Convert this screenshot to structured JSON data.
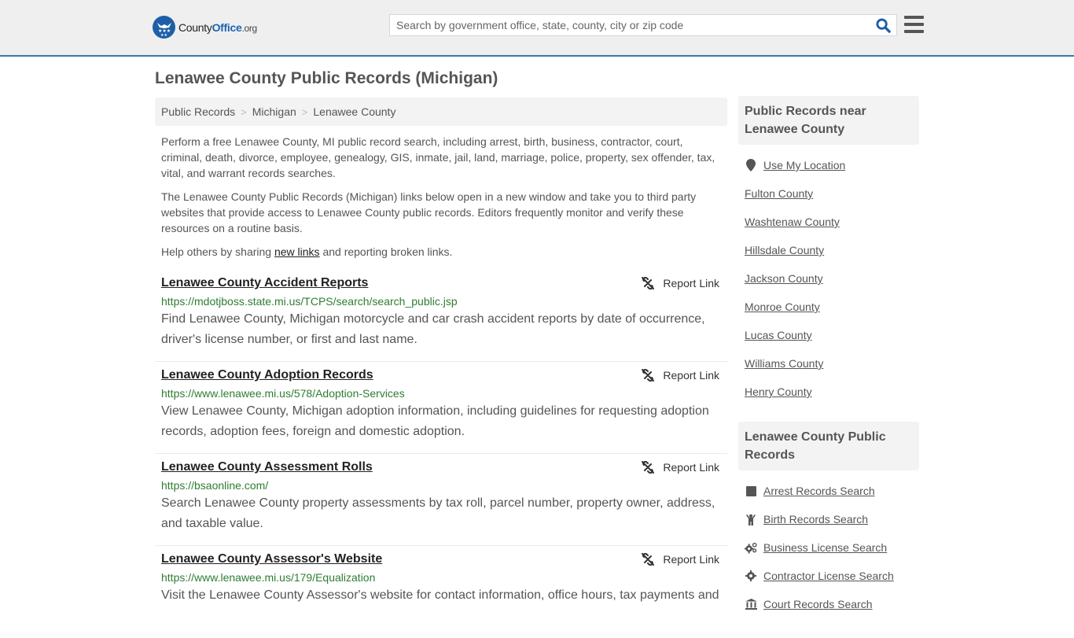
{
  "header": {
    "logo": {
      "county": "County",
      "office": "Office",
      "org": ".org"
    },
    "search": {
      "placeholder": "Search by government office, state, county, city or zip code",
      "value": ""
    }
  },
  "page": {
    "title": "Lenawee County Public Records (Michigan)"
  },
  "breadcrumb": [
    {
      "label": "Public Records"
    },
    {
      "label": "Michigan"
    },
    {
      "label": "Lenawee County"
    }
  ],
  "breadcrumb_separator": ">",
  "intro": {
    "p1": "Perform a free Lenawee County, MI public record search, including arrest, birth, business, contractor, court, criminal, death, divorce, employee, genealogy, GIS, inmate, jail, land, marriage, police, property, sex offender, tax, vital, and warrant records searches.",
    "p2": "The Lenawee County Public Records (Michigan) links below open in a new window and take you to third party websites that provide access to Lenawee County public records. Editors frequently monitor and verify these resources on a routine basis.",
    "p3_before": "Help others by sharing ",
    "p3_link": "new links",
    "p3_after": " and reporting broken links."
  },
  "report_link_label": "Report Link",
  "records": [
    {
      "title": "Lenawee County Accident Reports",
      "url": "https://mdotjboss.state.mi.us/TCPS/search/search_public.jsp",
      "description": "Find Lenawee County, Michigan motorcycle and car crash accident reports by date of occurrence, driver's license number, or first and last name."
    },
    {
      "title": "Lenawee County Adoption Records",
      "url": "https://www.lenawee.mi.us/578/Adoption-Services",
      "description": "View Lenawee County, Michigan adoption information, including guidelines for requesting adoption records, adoption fees, foreign and domestic adoption."
    },
    {
      "title": "Lenawee County Assessment Rolls",
      "url": "https://bsaonline.com/",
      "description": "Search Lenawee County property assessments by tax roll, parcel number, property owner, address, and taxable value."
    },
    {
      "title": "Lenawee County Assessor's Website",
      "url": "https://www.lenawee.mi.us/179/Equalization",
      "description": "Visit the Lenawee County Assessor's website for contact information, office hours, tax payments and"
    }
  ],
  "sidebar": {
    "nearby_heading": "Public Records near Lenawee County",
    "use_location": "Use My Location",
    "nearby": [
      "Fulton County",
      "Washtenaw County",
      "Hillsdale County",
      "Jackson County",
      "Monroe County",
      "Lucas County",
      "Williams County",
      "Henry County"
    ],
    "records_heading": "Lenawee County Public Records",
    "record_links": [
      {
        "label": "Arrest Records Search",
        "icon": "square-icon"
      },
      {
        "label": "Birth Records Search",
        "icon": "child-icon"
      },
      {
        "label": "Business License Search",
        "icon": "cogs-icon"
      },
      {
        "label": "Contractor License Search",
        "icon": "cog-icon"
      },
      {
        "label": "Court Records Search",
        "icon": "courthouse-icon"
      }
    ]
  },
  "colors": {
    "accent": "#3a77ad",
    "logo_blue": "#1e5ea8",
    "url_green": "#2e7d32",
    "text": "#555555",
    "panel": "#f3f3f3"
  }
}
